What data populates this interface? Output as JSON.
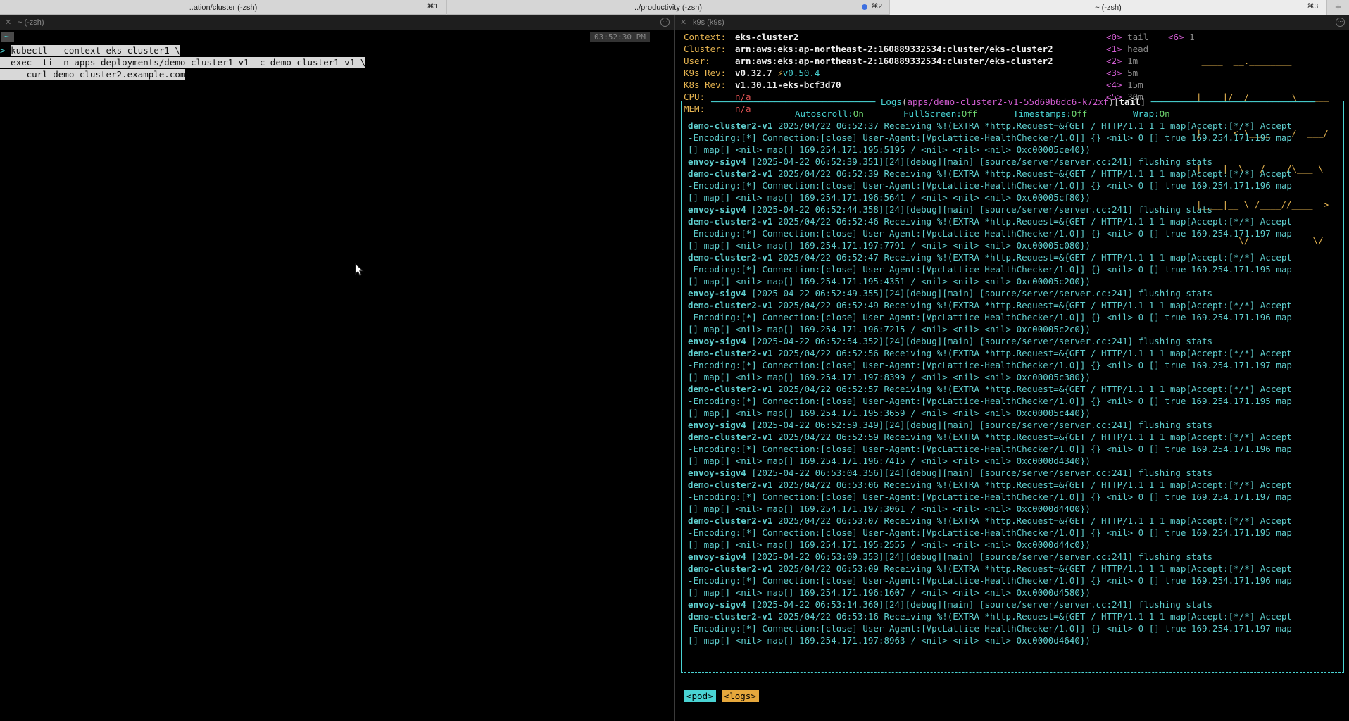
{
  "tabs": [
    {
      "title": "..ation/cluster (-zsh)",
      "shortcut": "⌘1",
      "has_dot": false
    },
    {
      "title": "../productivity (-zsh)",
      "shortcut": "⌘2",
      "has_dot": true
    },
    {
      "title": "~ (-zsh)",
      "shortcut": "⌘3",
      "has_dot": false
    }
  ],
  "new_tab_label": "+",
  "left_pane": {
    "header": "~ (-zsh)",
    "tilde": "~",
    "clock": "03:52:30 PM",
    "prompt_char": ">",
    "commands": [
      "kubectl --context eks-cluster1 \\",
      "  exec -ti -n apps deployments/demo-cluster1-v1 -c demo-cluster1-v1 \\",
      "  -- curl demo-cluster2.example.com"
    ]
  },
  "right_pane": {
    "header": "k9s (k9s)",
    "info": [
      {
        "key": "Context:",
        "value": "eks-cluster2",
        "style": "bold"
      },
      {
        "key": "Cluster:",
        "value": "arn:aws:eks:ap-northeast-2:160889332534:cluster/eks-cluster2",
        "style": "bold"
      },
      {
        "key": "User:",
        "value": "arn:aws:eks:ap-northeast-2:160889332534:cluster/eks-cluster2",
        "style": "bold"
      },
      {
        "key": "K9s Rev:",
        "value": "v0.32.7",
        "extra": "v0.50.4",
        "style": "bold"
      },
      {
        "key": "K8s Rev:",
        "value": "v1.30.11-eks-bcf3d70",
        "style": "bold"
      },
      {
        "key": "CPU:",
        "value": "n/a",
        "style": "red"
      },
      {
        "key": "MEM:",
        "value": "n/a",
        "style": "red"
      }
    ],
    "hotkeys": [
      {
        "key": "<0>",
        "label": "tail"
      },
      {
        "key": "<1>",
        "label": "head"
      },
      {
        "key": "<2>",
        "label": "1m"
      },
      {
        "key": "<3>",
        "label": "5m"
      },
      {
        "key": "<4>",
        "label": "15m"
      },
      {
        "key": "<5>",
        "label": "30m"
      },
      {
        "key": "<6>",
        "label": "1"
      }
    ],
    "logo_lines": [
      " ____  __.________",
      "|    |/ _/   __   \\______",
      "|      < \\____    /  ___/",
      "|    |  \\   /    /\\___ \\",
      "|____|__ \\ /____//____  >",
      "        \\/            \\/"
    ],
    "logs_title": {
      "label": "Logs",
      "pod": "apps/demo-cluster2-v1-55d69b6dc6-k72xf",
      "mode": "tail"
    },
    "flags": [
      {
        "key": "Autoscroll:",
        "value": "On"
      },
      {
        "key": "FullScreen:",
        "value": "Off"
      },
      {
        "key": "Timestamps:",
        "value": "Off"
      },
      {
        "key": "Wrap:",
        "value": "On"
      }
    ],
    "log_lines": [
      {
        "src": "demo-cluster2-v1",
        "text": " 2025/04/22 06:52:37 Receiving %!(EXTRA *http.Request=&{GET / HTTP/1.1 1 1 map[Accept:[*/*] Accept"
      },
      {
        "src": "",
        "text": "-Encoding:[*] Connection:[close] User-Agent:[VpcLattice-HealthChecker/1.0]] {} <nil> 0 [] true 169.254.171.195 map"
      },
      {
        "src": "",
        "text": "[] map[] <nil> map[] 169.254.171.195:5195 / <nil> <nil> <nil> 0xc00005ce40})"
      },
      {
        "src": "envoy-sigv4",
        "text": " [2025-04-22 06:52:39.351][24][debug][main] [source/server/server.cc:241] flushing stats"
      },
      {
        "src": "demo-cluster2-v1",
        "text": " 2025/04/22 06:52:39 Receiving %!(EXTRA *http.Request=&{GET / HTTP/1.1 1 1 map[Accept:[*/*] Accept"
      },
      {
        "src": "",
        "text": "-Encoding:[*] Connection:[close] User-Agent:[VpcLattice-HealthChecker/1.0]] {} <nil> 0 [] true 169.254.171.196 map"
      },
      {
        "src": "",
        "text": "[] map[] <nil> map[] 169.254.171.196:5641 / <nil> <nil> <nil> 0xc00005cf80})"
      },
      {
        "src": "envoy-sigv4",
        "text": " [2025-04-22 06:52:44.358][24][debug][main] [source/server/server.cc:241] flushing stats"
      },
      {
        "src": "demo-cluster2-v1",
        "text": " 2025/04/22 06:52:46 Receiving %!(EXTRA *http.Request=&{GET / HTTP/1.1 1 1 map[Accept:[*/*] Accept"
      },
      {
        "src": "",
        "text": "-Encoding:[*] Connection:[close] User-Agent:[VpcLattice-HealthChecker/1.0]] {} <nil> 0 [] true 169.254.171.197 map"
      },
      {
        "src": "",
        "text": "[] map[] <nil> map[] 169.254.171.197:7791 / <nil> <nil> <nil> 0xc00005c080})"
      },
      {
        "src": "demo-cluster2-v1",
        "text": " 2025/04/22 06:52:47 Receiving %!(EXTRA *http.Request=&{GET / HTTP/1.1 1 1 map[Accept:[*/*] Accept"
      },
      {
        "src": "",
        "text": "-Encoding:[*] Connection:[close] User-Agent:[VpcLattice-HealthChecker/1.0]] {} <nil> 0 [] true 169.254.171.195 map"
      },
      {
        "src": "",
        "text": "[] map[] <nil> map[] 169.254.171.195:4351 / <nil> <nil> <nil> 0xc00005c200})"
      },
      {
        "src": "envoy-sigv4",
        "text": " [2025-04-22 06:52:49.355][24][debug][main] [source/server/server.cc:241] flushing stats"
      },
      {
        "src": "demo-cluster2-v1",
        "text": " 2025/04/22 06:52:49 Receiving %!(EXTRA *http.Request=&{GET / HTTP/1.1 1 1 map[Accept:[*/*] Accept"
      },
      {
        "src": "",
        "text": "-Encoding:[*] Connection:[close] User-Agent:[VpcLattice-HealthChecker/1.0]] {} <nil> 0 [] true 169.254.171.196 map"
      },
      {
        "src": "",
        "text": "[] map[] <nil> map[] 169.254.171.196:7215 / <nil> <nil> <nil> 0xc00005c2c0})"
      },
      {
        "src": "envoy-sigv4",
        "text": " [2025-04-22 06:52:54.352][24][debug][main] [source/server/server.cc:241] flushing stats"
      },
      {
        "src": "demo-cluster2-v1",
        "text": " 2025/04/22 06:52:56 Receiving %!(EXTRA *http.Request=&{GET / HTTP/1.1 1 1 map[Accept:[*/*] Accept"
      },
      {
        "src": "",
        "text": "-Encoding:[*] Connection:[close] User-Agent:[VpcLattice-HealthChecker/1.0]] {} <nil> 0 [] true 169.254.171.197 map"
      },
      {
        "src": "",
        "text": "[] map[] <nil> map[] 169.254.171.197:8399 / <nil> <nil> <nil> 0xc00005c380})"
      },
      {
        "src": "demo-cluster2-v1",
        "text": " 2025/04/22 06:52:57 Receiving %!(EXTRA *http.Request=&{GET / HTTP/1.1 1 1 map[Accept:[*/*] Accept"
      },
      {
        "src": "",
        "text": "-Encoding:[*] Connection:[close] User-Agent:[VpcLattice-HealthChecker/1.0]] {} <nil> 0 [] true 169.254.171.195 map"
      },
      {
        "src": "",
        "text": "[] map[] <nil> map[] 169.254.171.195:3659 / <nil> <nil> <nil> 0xc00005c440})"
      },
      {
        "src": "envoy-sigv4",
        "text": " [2025-04-22 06:52:59.349][24][debug][main] [source/server/server.cc:241] flushing stats"
      },
      {
        "src": "demo-cluster2-v1",
        "text": " 2025/04/22 06:52:59 Receiving %!(EXTRA *http.Request=&{GET / HTTP/1.1 1 1 map[Accept:[*/*] Accept"
      },
      {
        "src": "",
        "text": "-Encoding:[*] Connection:[close] User-Agent:[VpcLattice-HealthChecker/1.0]] {} <nil> 0 [] true 169.254.171.196 map"
      },
      {
        "src": "",
        "text": "[] map[] <nil> map[] 169.254.171.196:7415 / <nil> <nil> <nil> 0xc0000d4340})"
      },
      {
        "src": "envoy-sigv4",
        "text": " [2025-04-22 06:53:04.356][24][debug][main] [source/server/server.cc:241] flushing stats"
      },
      {
        "src": "demo-cluster2-v1",
        "text": " 2025/04/22 06:53:06 Receiving %!(EXTRA *http.Request=&{GET / HTTP/1.1 1 1 map[Accept:[*/*] Accept"
      },
      {
        "src": "",
        "text": "-Encoding:[*] Connection:[close] User-Agent:[VpcLattice-HealthChecker/1.0]] {} <nil> 0 [] true 169.254.171.197 map"
      },
      {
        "src": "",
        "text": "[] map[] <nil> map[] 169.254.171.197:3061 / <nil> <nil> <nil> 0xc0000d4400})"
      },
      {
        "src": "demo-cluster2-v1",
        "text": " 2025/04/22 06:53:07 Receiving %!(EXTRA *http.Request=&{GET / HTTP/1.1 1 1 map[Accept:[*/*] Accept"
      },
      {
        "src": "",
        "text": "-Encoding:[*] Connection:[close] User-Agent:[VpcLattice-HealthChecker/1.0]] {} <nil> 0 [] true 169.254.171.195 map"
      },
      {
        "src": "",
        "text": "[] map[] <nil> map[] 169.254.171.195:2555 / <nil> <nil> <nil> 0xc0000d44c0})"
      },
      {
        "src": "envoy-sigv4",
        "text": " [2025-04-22 06:53:09.353][24][debug][main] [source/server/server.cc:241] flushing stats"
      },
      {
        "src": "demo-cluster2-v1",
        "text": " 2025/04/22 06:53:09 Receiving %!(EXTRA *http.Request=&{GET / HTTP/1.1 1 1 map[Accept:[*/*] Accept"
      },
      {
        "src": "",
        "text": "-Encoding:[*] Connection:[close] User-Agent:[VpcLattice-HealthChecker/1.0]] {} <nil> 0 [] true 169.254.171.196 map"
      },
      {
        "src": "",
        "text": "[] map[] <nil> map[] 169.254.171.196:1607 / <nil> <nil> <nil> 0xc0000d4580})"
      },
      {
        "src": "envoy-sigv4",
        "text": " [2025-04-22 06:53:14.360][24][debug][main] [source/server/server.cc:241] flushing stats"
      },
      {
        "src": "demo-cluster2-v1",
        "text": " 2025/04/22 06:53:16 Receiving %!(EXTRA *http.Request=&{GET / HTTP/1.1 1 1 map[Accept:[*/*] Accept"
      },
      {
        "src": "",
        "text": "-Encoding:[*] Connection:[close] User-Agent:[VpcLattice-HealthChecker/1.0]] {} <nil> 0 [] true 169.254.171.197 map"
      },
      {
        "src": "",
        "text": "[] map[] <nil> map[] 169.254.171.197:8963 / <nil> <nil> <nil> 0xc0000d4640})"
      }
    ],
    "crumbs": [
      "<pod>",
      "<logs>"
    ]
  },
  "colors": {
    "accent_cyan": "#49d3d3",
    "accent_orange": "#e6b450",
    "accent_magenta": "#d15cd1"
  }
}
